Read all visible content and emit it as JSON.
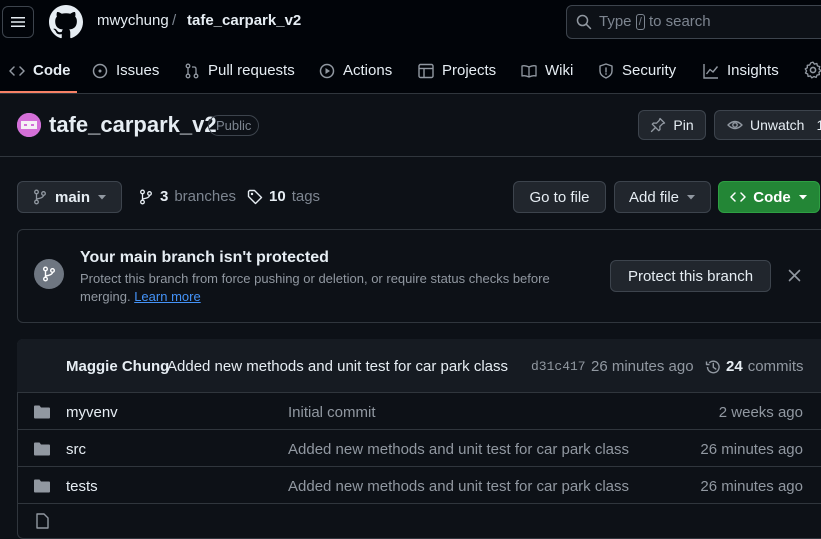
{
  "header": {
    "owner": "mwychung",
    "separator": "/",
    "repo": "tafe_carpark_v2",
    "search_prefix": "Type",
    "search_key": "/",
    "search_suffix": "to search"
  },
  "tabs": [
    {
      "label": "Code",
      "icon": "code-icon"
    },
    {
      "label": "Issues",
      "icon": "issue-icon"
    },
    {
      "label": "Pull requests",
      "icon": "pull-request-icon"
    },
    {
      "label": "Actions",
      "icon": "play-icon"
    },
    {
      "label": "Projects",
      "icon": "table-icon"
    },
    {
      "label": "Wiki",
      "icon": "book-icon"
    },
    {
      "label": "Security",
      "icon": "shield-icon"
    },
    {
      "label": "Insights",
      "icon": "graph-icon"
    }
  ],
  "repo_header": {
    "title": "tafe_carpark_v2",
    "visibility": "Public",
    "pin_label": "Pin",
    "unwatch_label": "Unwatch",
    "watch_count": "1"
  },
  "branch_bar": {
    "branch": "main",
    "branches_count": "3",
    "branches_label": "branches",
    "tags_count": "10",
    "tags_label": "tags",
    "goto_file": "Go to file",
    "add_file": "Add file",
    "code": "Code"
  },
  "protection": {
    "title": "Your main branch isn't protected",
    "desc": "Protect this branch from force pushing or deletion, or require status checks before merging.",
    "learn_more": "Learn more",
    "button": "Protect this branch"
  },
  "latest_commit": {
    "author": "Maggie Chung",
    "message": "Added new methods and unit test for car park class",
    "hash": "d31c417",
    "time": "26 minutes ago",
    "count": "24",
    "count_label": "commits"
  },
  "files": [
    {
      "name": "myvenv",
      "message": "Initial commit",
      "time": "2 weeks ago"
    },
    {
      "name": "src",
      "message": "Added new methods and unit test for car park class",
      "time": "26 minutes ago"
    },
    {
      "name": "tests",
      "message": "Added new methods and unit test for car park class",
      "time": "26 minutes ago"
    }
  ],
  "colors": {
    "background": "#0d1117",
    "header": "#010409",
    "accent_green": "#238636",
    "link": "#4493f8",
    "tab_underline": "#f78166"
  }
}
